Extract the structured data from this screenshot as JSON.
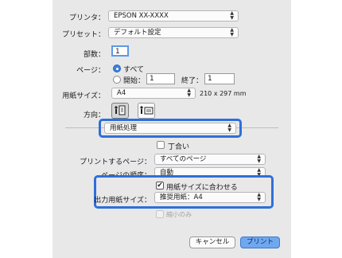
{
  "printer": {
    "label": "プリンタ：",
    "value": "EPSON XX-XXXX"
  },
  "preset": {
    "label": "プリセット：",
    "value": "デフォルト設定"
  },
  "copies": {
    "label": "部数：",
    "value": "1"
  },
  "pages": {
    "label": "ページ：",
    "all_label": "すべて",
    "from_label": "開始：",
    "from_value": "1",
    "to_label": "終了：",
    "to_value": "1"
  },
  "paper_size": {
    "label": "用紙サイズ：",
    "value": "A4",
    "dimensions": "210 x 297 mm"
  },
  "orientation": {
    "label": "方向："
  },
  "section_popup": {
    "value": "用紙処理"
  },
  "collate": {
    "label": "丁合い"
  },
  "pages_to_print": {
    "label": "プリントするページ：",
    "value": "すべてのページ"
  },
  "page_order": {
    "label": "ページの順序：",
    "value": "自動"
  },
  "scale_to_fit": {
    "label": "用紙サイズに合わせる",
    "checked": true
  },
  "output_paper_size": {
    "label": "出力用紙サイズ：",
    "value": "推奨用紙：A4"
  },
  "scale_down_only": {
    "label": "縮小のみ"
  },
  "buttons": {
    "cancel": "キャンセル",
    "print": "プリント"
  },
  "colors": {
    "highlight": "#2f6fd8",
    "accent": "#3b82e0"
  }
}
